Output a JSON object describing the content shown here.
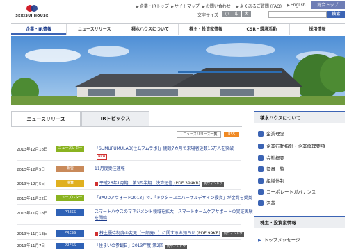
{
  "brand": {
    "name": "SEKISUI HOUSE"
  },
  "top_links": [
    {
      "label": "企業・IRトップ"
    },
    {
      "label": "サイトマップ"
    },
    {
      "label": "お問い合わせ"
    },
    {
      "label": "よくあるご質問 (FAQ)"
    },
    {
      "label": "English"
    }
  ],
  "corporate_top": "総合トップ",
  "font_size": {
    "label": "文字サイズ",
    "options": [
      "小",
      "中",
      "大"
    ]
  },
  "search": {
    "button": "検索",
    "placeholder": ""
  },
  "nav": [
    {
      "label": "企業・IR情報",
      "active": true
    },
    {
      "label": "ニュースリリース"
    },
    {
      "label": "積水ハウスについて"
    },
    {
      "label": "株主・投資家情報"
    },
    {
      "label": "CSR・環境活動"
    },
    {
      "label": "採用情報"
    }
  ],
  "tabs": {
    "news": "ニュースリリース",
    "ir": "IRトピックス"
  },
  "news_list_button": "ニュースリリース一覧",
  "rss": "RSS",
  "news": [
    {
      "date": "2013年12月18日",
      "category": "ニューズレター",
      "color": "#8ab320",
      "title": "「SUMUFUMULAB(住ムフムラボ)」開設7カ月で来場者延数15万人を突破",
      "new": "NEW"
    },
    {
      "date": "2013年12月5日",
      "category": "報告",
      "color": "#c98a5a",
      "title": "11月度受注速報"
    },
    {
      "date": "2013年12月5日",
      "category": "決算",
      "color": "#e0b020",
      "title": "平成26年1月期　第3四半期　決算短信",
      "suffix": "(PDF 394KB)",
      "window": "別ウィンドウ"
    },
    {
      "date": "2013年11月22日",
      "category": "ニューズレター",
      "color": "#8ab320",
      "title": "「3AUDアウォード2013」で、「ドクターユニバーサルデザイン授賞」が金賞を受賞"
    },
    {
      "date": "2013年11月18日",
      "category": "PRESS",
      "color": "#2f62b6",
      "title": "スマートハウスのマネジメント領域を拡大　スマートホームケアサポートの実証実験",
      "title2": "を開始"
    },
    {
      "date": "2013年11月13日",
      "category": "PRESS",
      "color": "#2f62b6",
      "title": "株主優待制度の変更（一部廃止）に関するお知らせ",
      "suffix": "(PDF 99KB)",
      "window": "別ウィンドウ"
    },
    {
      "date": "2013年11月7日",
      "category": "PRESS",
      "color": "#2f62b6",
      "title": "「住まいの参観日」2013年度 第2回",
      "window": "別ウィンドウ"
    }
  ],
  "sidebar": {
    "about_title": "積水ハウスについて",
    "about_items": [
      {
        "label": "企業理念",
        "icon": "philosophy-icon"
      },
      {
        "label": "企業行動指針・企業倫理要項",
        "icon": "guideline-icon"
      },
      {
        "label": "会社概要",
        "icon": "building-icon"
      },
      {
        "label": "役員一覧",
        "icon": "people-icon"
      },
      {
        "label": "組織体制",
        "icon": "organization-icon"
      },
      {
        "label": "コーポレートガバナンス",
        "icon": "governance-icon"
      },
      {
        "label": "沿革",
        "icon": "history-icon"
      }
    ],
    "investor_title": "株主・投資家情報",
    "investor_items": [
      {
        "label": "トップメッセージ",
        "icon": "arrow-icon"
      }
    ]
  }
}
